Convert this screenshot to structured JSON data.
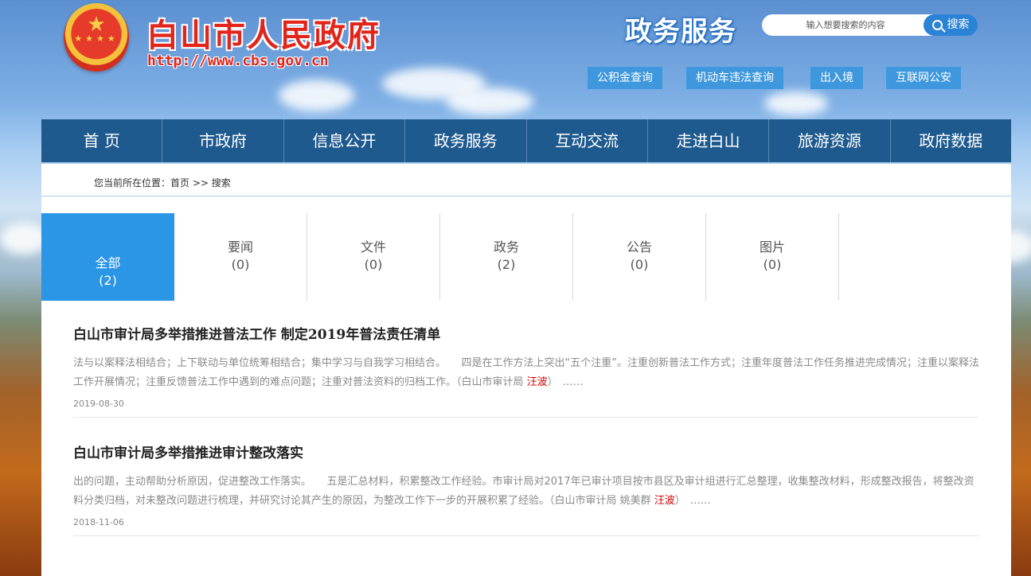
{
  "header": {
    "site_title": "白山市人民政府",
    "site_url": "http://www.cbs.gov.cn",
    "section_title": "政务服务",
    "search": {
      "placeholder": "输入想要搜索的内容",
      "button_label": "搜索"
    },
    "quick_links": [
      "公积金查询",
      "机动车违法查询",
      "出入境",
      "互联网公安"
    ]
  },
  "nav": [
    "首 页",
    "市政府",
    "信息公开",
    "政务服务",
    "互动交流",
    "走进白山",
    "旅游资源",
    "政府数据"
  ],
  "breadcrumb": {
    "prefix": "您当前所在位置：",
    "home": "首页",
    "sep": " >> ",
    "current": "搜索"
  },
  "tabs": [
    {
      "label": "全部",
      "count": "(2)",
      "active": true
    },
    {
      "label": "要闻",
      "count": "(0)",
      "active": false
    },
    {
      "label": "文件",
      "count": "(0)",
      "active": false
    },
    {
      "label": "政务",
      "count": "(2)",
      "active": false
    },
    {
      "label": "公告",
      "count": "(0)",
      "active": false
    },
    {
      "label": "图片",
      "count": "(0)",
      "active": false
    }
  ],
  "results": [
    {
      "title": "白山市审计局多举措推进普法工作 制定2019年普法责任清单",
      "snippet_before": "法与以案释法相结合；上下联动与单位统筹相结合；集中学习与自我学习相结合。　　四是在工作方法上突出“五个注重”。注重创新普法工作方式；注重年度普法工作任务推进完成情况；注重以案释法工作开展情况；注重反馈普法工作中遇到的难点问题；注重对普法资料的归档工作。（白山市审计局 ",
      "snippet_highlight": "汪波",
      "snippet_after": "）",
      "ellipsis": "……",
      "date": "2019-08-30"
    },
    {
      "title": "白山市审计局多举措推进审计整改落实",
      "snippet_before": "出的问题，主动帮助分析原因，促进整改工作落实。　　五是汇总材料，积累整改工作经验。市审计局对2017年已审计项目按市县区及审计组进行汇总整理，收集整改材料，形成整改报告，将整改资料分类归档，对未整改问题进行梳理，并研究讨论其产生的原因，为整改工作下一步的开展积累了经验。（白山市审计局 姚美群 ",
      "snippet_highlight": "汪波",
      "snippet_after": "）",
      "ellipsis": "……",
      "date": "2018-11-06"
    }
  ],
  "colors": {
    "nav_bg": "#1f5a8f",
    "tab_active": "#2b95e6",
    "title_red": "#e1251b",
    "highlight": "#d40000"
  }
}
